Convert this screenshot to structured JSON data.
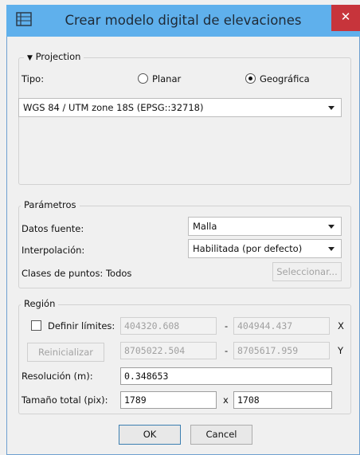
{
  "window": {
    "title": "Crear modelo digital de elevaciones",
    "close_glyph": "✕",
    "accent": "#5fb0ec"
  },
  "projection": {
    "legend": "Projection",
    "toggle_glyph": "▼",
    "tipo_label": "Tipo:",
    "radio_planar": "Planar",
    "radio_geografica": "Geográfica",
    "selected": "Geográfica",
    "crs_value": "WGS 84 / UTM zone 18S (EPSG::32718)"
  },
  "parametros": {
    "legend": "Parámetros",
    "datos_fuente_label": "Datos fuente:",
    "datos_fuente_value": "Malla",
    "interpolacion_label": "Interpolación:",
    "interpolacion_value": "Habilitada (por defecto)",
    "clases_label": "Clases de puntos: Todos",
    "seleccionar_label": "Seleccionar..."
  },
  "region": {
    "legend": "Región",
    "definir_label": "Definir límites:",
    "definir_checked": false,
    "reinicializar_label": "Reinicializar",
    "x_min": "404320.608",
    "x_max": "404944.437",
    "y_min": "8705022.504",
    "y_max": "8705617.959",
    "dash": "-",
    "x_axis": "X",
    "y_axis": "Y",
    "resolucion_label": "Resolución (m):",
    "resolucion_value": "0.348653",
    "tamano_label": "Tamaño total (pix):",
    "tamano_w": "1789",
    "times": "x",
    "tamano_h": "1708"
  },
  "buttons": {
    "ok": "OK",
    "cancel": "Cancel"
  }
}
